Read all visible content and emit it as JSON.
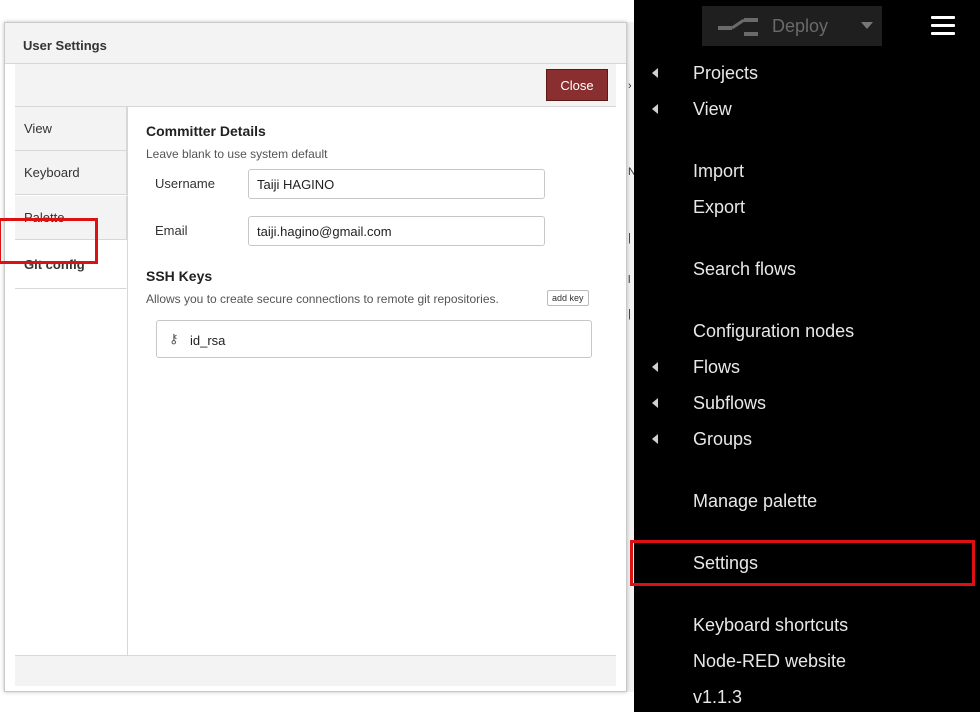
{
  "dialog": {
    "title": "User Settings",
    "close_label": "Close",
    "tabs": [
      {
        "label": "View"
      },
      {
        "label": "Keyboard"
      },
      {
        "label": "Palette"
      },
      {
        "label": "Git config"
      }
    ]
  },
  "git_config": {
    "committer_title": "Committer Details",
    "committer_hint": "Leave blank to use system default",
    "username_label": "Username",
    "username_value": "Taiji HAGINO",
    "email_label": "Email",
    "email_value": "taiji.hagino@gmail.com",
    "ssh_title": "SSH Keys",
    "ssh_hint": "Allows you to create secure connections to remote git repositories.",
    "add_key_label": "add key",
    "keys": [
      {
        "name": "id_rsa"
      }
    ]
  },
  "header": {
    "deploy_label": "Deploy"
  },
  "menu": {
    "items": [
      {
        "label": "Projects"
      },
      {
        "label": "View"
      },
      {
        "label": "Import"
      },
      {
        "label": "Export"
      },
      {
        "label": "Search flows"
      },
      {
        "label": "Configuration nodes"
      },
      {
        "label": "Flows"
      },
      {
        "label": "Subflows"
      },
      {
        "label": "Groups"
      },
      {
        "label": "Manage palette"
      },
      {
        "label": "Settings"
      },
      {
        "label": "Keyboard shortcuts"
      },
      {
        "label": "Node-RED website"
      },
      {
        "label": "v1.1.3"
      }
    ]
  },
  "colors": {
    "close_button": "#8a2f2f",
    "highlight": "#dd1111",
    "menu_background": "#000000"
  }
}
